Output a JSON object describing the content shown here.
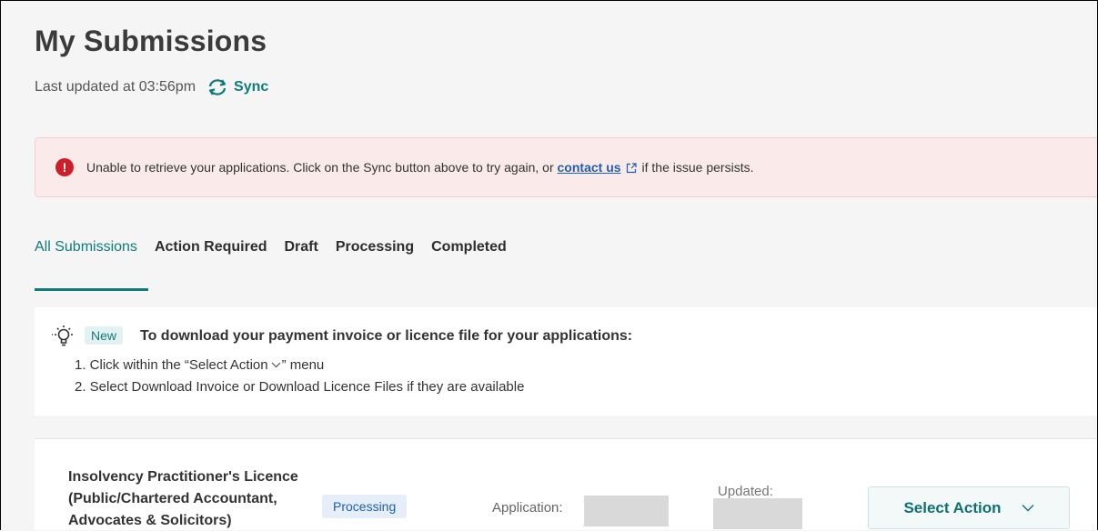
{
  "header": {
    "title": "My Submissions",
    "last_updated": "Last updated at 03:56pm",
    "sync_label": "Sync"
  },
  "alert": {
    "icon_glyph": "!",
    "text_before": "Unable to retrieve your applications. Click on the Sync button above to try again, or",
    "link_text": "contact us",
    "text_after": "if the issue persists.",
    "color": "#cc1f2a"
  },
  "tabs": [
    {
      "label": "All Submissions",
      "active": true
    },
    {
      "label": "Action Required",
      "active": false
    },
    {
      "label": "Draft",
      "active": false
    },
    {
      "label": "Processing",
      "active": false
    },
    {
      "label": "Completed",
      "active": false
    }
  ],
  "info": {
    "badge": "New",
    "title": "To download your payment invoice or licence file for your applications:",
    "step1_before": "1. Click within the “Select Action",
    "step1_after": "” menu",
    "step2": "2. Select Download Invoice or Download Licence Files if they are available"
  },
  "application": {
    "name_line1": "Insolvency Practitioner's Licence",
    "name_line2": "(Public/Chartered Accountant,",
    "name_line3": "Advocates & Solicitors)",
    "status": "Processing",
    "application_label": "Application:",
    "updated_label": "Updated:",
    "action_button": "Select Action"
  },
  "colors": {
    "accent": "#0f7b7b",
    "alert_bg": "#fbeaea",
    "status_bg": "#e5eef9",
    "status_text": "#1e5fb0"
  },
  "icons": [
    "sync-icon",
    "error-icon",
    "external-link-icon",
    "lightbulb-icon",
    "chevron-down-icon"
  ]
}
